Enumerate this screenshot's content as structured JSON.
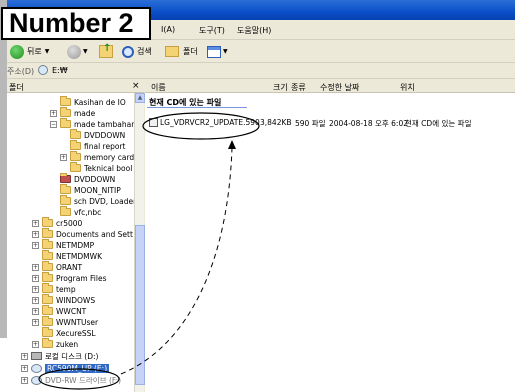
{
  "label": {
    "text": "Number 2"
  },
  "menu": {
    "items": [
      "I(A)",
      "도구(T)",
      "도움말(H)"
    ]
  },
  "toolbar": {
    "back": "뒤로",
    "search": "검색",
    "folders": "폴더"
  },
  "address": {
    "label": "주소(D)",
    "value": "E:₩"
  },
  "folder_pane": {
    "header": "폴더",
    "close": "×",
    "items": [
      {
        "label": "Kasihan de IO",
        "expander": ""
      },
      {
        "label": "made",
        "expander": "+"
      },
      {
        "label": "made tambahan",
        "expander": "−"
      },
      {
        "label": "DVDDOWN",
        "expander": ""
      },
      {
        "label": "final report",
        "expander": ""
      },
      {
        "label": "memory card",
        "expander": "+"
      },
      {
        "label": "Teknical bool",
        "expander": ""
      },
      {
        "label": "DVDDOWN",
        "expander": ""
      },
      {
        "label": "MOON_NITIP",
        "expander": ""
      },
      {
        "label": "sch DVD, Loader",
        "expander": ""
      },
      {
        "label": "vfc,nbc",
        "expander": ""
      },
      {
        "label": "cr5000",
        "expander": "+"
      },
      {
        "label": "Documents and Sett",
        "expander": "+"
      },
      {
        "label": "NETMDMP",
        "expander": "+"
      },
      {
        "label": "NETMDMWK",
        "expander": ""
      },
      {
        "label": "ORANT",
        "expander": "+"
      },
      {
        "label": "Program Files",
        "expander": "+"
      },
      {
        "label": "temp",
        "expander": "+"
      },
      {
        "label": "WINDOWS",
        "expander": "+"
      },
      {
        "label": "WWCNT",
        "expander": "+"
      },
      {
        "label": "WWNTUser",
        "expander": "+"
      },
      {
        "label": "XecureSSL",
        "expander": ""
      },
      {
        "label": "zuken",
        "expander": "+"
      },
      {
        "label": "로컬 디스크 (D:)",
        "expander": "+"
      },
      {
        "label": "RC590M_UP (E:)",
        "expander": "+"
      },
      {
        "label": "DVD-RW 드라이브 (F:)",
        "expander": "+"
      }
    ]
  },
  "file_pane": {
    "columns": [
      "이름",
      "크기",
      "종류",
      "수정한 날짜",
      "위치"
    ],
    "group_title": "현재 CD에 있는 파일",
    "files": [
      {
        "name": "LG_VDRVCR2_UPDATE.590",
        "size": "3,842KB",
        "type": "590 파일",
        "date": "2004-08-18 오후 6:02",
        "location": "현재 CD에 있는 파일"
      }
    ]
  }
}
